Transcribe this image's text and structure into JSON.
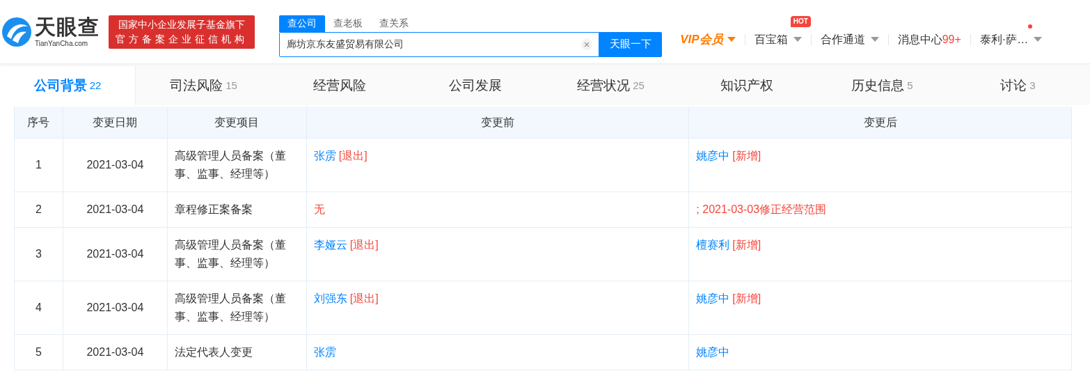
{
  "header": {
    "logo": {
      "name": "天眼查",
      "domain": "TianYanCha.com"
    },
    "banner": [
      "国家中小企业发展子基金旗下",
      "官方备案企业征信机构"
    ],
    "search": {
      "tabs": [
        {
          "label": "查公司",
          "selected": true
        },
        {
          "label": "查老板",
          "selected": false
        },
        {
          "label": "查关系",
          "selected": false
        }
      ],
      "value": "廊坊京东友盛贸易有限公司",
      "button": "天眼一下"
    },
    "nav": [
      {
        "kind": "vip",
        "label": "VIP会员"
      },
      {
        "kind": "menu",
        "label": "百宝箱",
        "badge": "HOT"
      },
      {
        "kind": "menu",
        "label": "合作通道"
      },
      {
        "kind": "count",
        "label": "消息中心",
        "count": "99+"
      },
      {
        "kind": "user",
        "label": "泰利·萨…",
        "dot": true
      }
    ]
  },
  "tabs": [
    {
      "label": "公司背景",
      "count": "22",
      "selected": true
    },
    {
      "label": "司法风险",
      "count": "15",
      "selected": false
    },
    {
      "label": "经营风险",
      "selected": false
    },
    {
      "label": "公司发展",
      "selected": false
    },
    {
      "label": "经营状况",
      "count": "25",
      "selected": false
    },
    {
      "label": "知识产权",
      "selected": false
    },
    {
      "label": "历史信息",
      "count": "5",
      "selected": false
    },
    {
      "label": "讨论",
      "count": "3",
      "selected": false
    }
  ],
  "table": {
    "columns": [
      "序号",
      "变更日期",
      "变更项目",
      "变更前",
      "变更后"
    ],
    "rows": [
      {
        "no": "1",
        "date": "2021-03-04",
        "item": "高级管理人员备案（董事、监事、经理等）",
        "before": [
          {
            "kind": "person",
            "text": "张雳"
          },
          {
            "kind": "tag",
            "text": "[退出]"
          }
        ],
        "after": [
          {
            "kind": "person",
            "text": "姚彦中"
          },
          {
            "kind": "tag",
            "text": "[新增]"
          }
        ]
      },
      {
        "no": "2",
        "date": "2021-03-04",
        "item": "章程修正案备案",
        "before": [
          {
            "kind": "tag",
            "text": "无"
          }
        ],
        "after": [
          {
            "kind": "tag",
            "text": "; 2021-03-03修正经营范围"
          }
        ]
      },
      {
        "no": "3",
        "date": "2021-03-04",
        "item": "高级管理人员备案（董事、监事、经理等）",
        "before": [
          {
            "kind": "person",
            "text": "李娅云"
          },
          {
            "kind": "tag",
            "text": "[退出]"
          }
        ],
        "after": [
          {
            "kind": "person",
            "text": "檀赛利"
          },
          {
            "kind": "tag",
            "text": "[新增]"
          }
        ]
      },
      {
        "no": "4",
        "date": "2021-03-04",
        "item": "高级管理人员备案（董事、监事、经理等）",
        "before": [
          {
            "kind": "person",
            "text": "刘强东"
          },
          {
            "kind": "tag",
            "text": "[退出]"
          }
        ],
        "after": [
          {
            "kind": "person",
            "text": "姚彦中"
          },
          {
            "kind": "tag",
            "text": "[新增]"
          }
        ]
      },
      {
        "no": "5",
        "date": "2021-03-04",
        "item": "法定代表人变更",
        "before": [
          {
            "kind": "person",
            "text": "张雳"
          }
        ],
        "after": [
          {
            "kind": "person",
            "text": "姚彦中"
          }
        ]
      }
    ]
  }
}
